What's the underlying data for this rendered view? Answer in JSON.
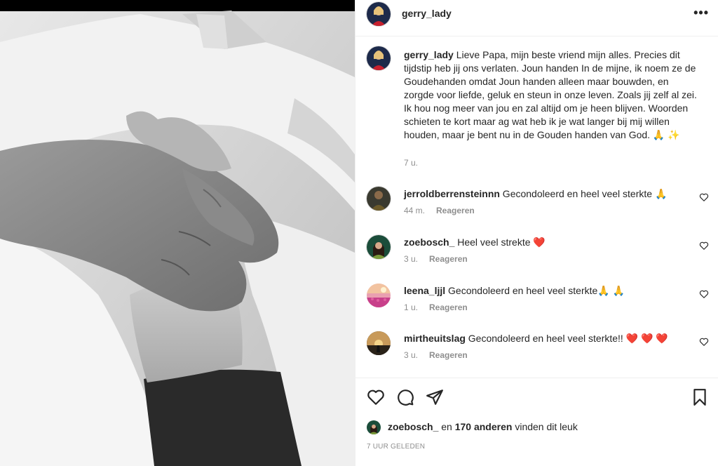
{
  "post": {
    "username": "gerry_lady",
    "more_label": "•••"
  },
  "caption": {
    "username": "gerry_lady",
    "text": " Lieve Papa, mijn beste vriend mijn alles. Precies dit tijdstip heb jij ons verlaten. Joun handen In de mijne, ik noem ze de Goudehanden omdat Joun handen alleen maar bouwden, en zorgde voor liefde, geluk en steun in onze leven. Zoals jij zelf al zei. Ik hou nog meer van jou en zal altijd om je heen blijven. Woorden schieten te kort maar ag wat heb ik je wat langer bij mij willen houden, maar je bent nu in de Gouden handen van God. 🙏 ✨",
    "time": "7 u."
  },
  "comments": [
    {
      "username": "jerroldberrensteinnn",
      "text": " Gecondoleerd en heel veel sterkte 🙏",
      "time": "44 m.",
      "reply": "Reageren"
    },
    {
      "username": "zoebosch_",
      "text": " Heel veel strekte ❤️",
      "time": "3 u.",
      "reply": "Reageren"
    },
    {
      "username": "leena_ljjl",
      "text": " Gecondoleerd en heel veel sterkte🙏 🙏",
      "time": "1 u.",
      "reply": "Reageren"
    },
    {
      "username": "mirtheuitslag",
      "text": " Gecondoleerd en heel veel sterkte!! ❤️ ❤️ ❤️",
      "time": "3 u.",
      "reply": "Reageren"
    }
  ],
  "likes": {
    "user": "zoebosch_",
    "middle": " en ",
    "count": "170 anderen",
    "suffix": " vinden dit leuk"
  },
  "posted_ago": "7 UUR GELEDEN",
  "icons": [
    "heart-icon",
    "comment-icon",
    "share-icon",
    "bookmark-icon",
    "more-icon"
  ],
  "colors": {
    "text": "#262626",
    "muted": "#8e8e8e",
    "border": "#efefef",
    "heart_red": "#ed4956"
  }
}
